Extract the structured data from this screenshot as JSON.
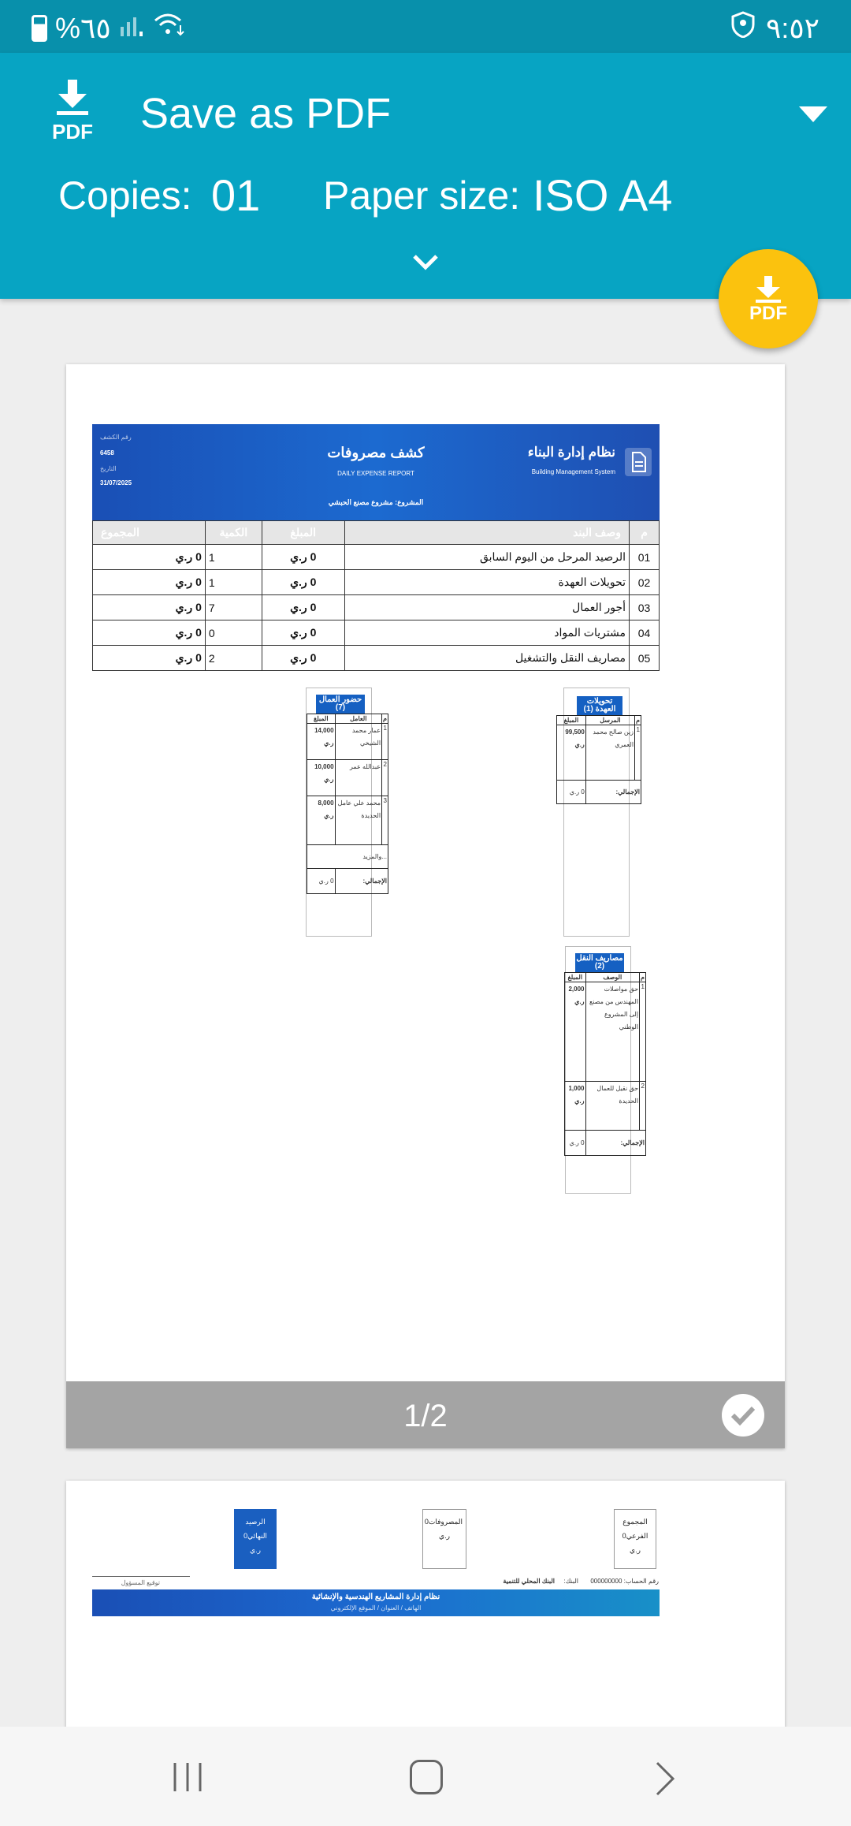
{
  "status_bar": {
    "battery": "%٦٥",
    "time": "٩:٥٢"
  },
  "header": {
    "title": "Save as PDF",
    "copies_label": "Copies:",
    "copies_value": "01",
    "paper_label": "Paper size:",
    "paper_value": "ISO A4",
    "pdf_icon_text": "PDF"
  },
  "fab": {
    "label": "PDF"
  },
  "page1": {
    "system_title": "نظام إدارة البناء",
    "system_subtitle": "Building Management System",
    "report_title": "كشف مصروفات",
    "report_subtitle": "DAILY EXPENSE REPORT",
    "project": "المشروع: مشروع مصنع الحبشي",
    "sheet_no_label": "رقم الكشف",
    "sheet_no": "6458",
    "date_label": "التاريخ",
    "date": "31/07/2025",
    "columns": [
      "م",
      "وصف البند",
      "المبلغ",
      "الكمية",
      "المجموع"
    ],
    "rows": [
      {
        "no": "01",
        "desc": "الرصيد المرحل من اليوم السابق",
        "amount": "0 ر.ي",
        "qty": "1",
        "total": "0 ر.ي"
      },
      {
        "no": "02",
        "desc": "تحويلات العهدة",
        "amount": "0 ر.ي",
        "qty": "1",
        "total": "0 ر.ي"
      },
      {
        "no": "03",
        "desc": "أجور العمال",
        "amount": "0 ر.ي",
        "qty": "7",
        "total": "0 ر.ي"
      },
      {
        "no": "04",
        "desc": "مشتريات المواد",
        "amount": "0 ر.ي",
        "qty": "0",
        "total": "0 ر.ي"
      },
      {
        "no": "05",
        "desc": "مصاريف النقل والتشغيل",
        "amount": "0 ر.ي",
        "qty": "2",
        "total": "0 ر.ي"
      }
    ],
    "transfers": {
      "title": "تحويلات العهدة (1)",
      "cols": [
        "م",
        "المرسل",
        "المبلغ"
      ],
      "rows": [
        {
          "no": "1",
          "name": "زين صالح محمد العمري",
          "amount": "99,500 ر.ي"
        }
      ],
      "total_label": "الإجمالي:",
      "total": "0 ر.ي"
    },
    "workers": {
      "title": "حضور العمال (7)",
      "cols": [
        "م",
        "العامل",
        "المبلغ"
      ],
      "rows": [
        {
          "no": "1",
          "name": "عمار محمد الشيخي",
          "amount": "14,000 ر.ي"
        },
        {
          "no": "2",
          "name": "عبدالله عمر",
          "amount": "10,000 ر.ي"
        },
        {
          "no": "3",
          "name": "محمد علي عامل الحديدة",
          "amount": "8,000 ر.ي"
        }
      ],
      "more": "...والمزيد",
      "total_label": "الإجمالي:",
      "total": "0 ر.ي"
    },
    "transport": {
      "title": "مصاريف النقل (2)",
      "cols": [
        "م",
        "الوصف",
        "المبلغ"
      ],
      "rows": [
        {
          "no": "1",
          "name": "حق مواصلات المهندس من مصنع إلى المشروع الوطني",
          "amount": "2,000 ر.ي"
        },
        {
          "no": "2",
          "name": "حق نقيل للعمال الحديدة",
          "amount": "1,000 ر.ي"
        }
      ],
      "total_label": "الإجمالي:",
      "total": "0 ر.ي"
    },
    "page_indicator": "1/2"
  },
  "page2": {
    "subtotal": "المجموع الفرعي0 ر.ي",
    "expenses": "المصروفات0 ر.ي",
    "final_balance": "الرصيد النهائي0 ر.ي",
    "account": "رقم الحساب: 000000000",
    "bank_label": "البنك:",
    "bank": "البنك المحلي للتنمية",
    "signature": "توقيع المسؤول",
    "footer_title": "نظام إدارة المشاريع الهندسية والإنشائية",
    "footer_sub": "الهاتف / العنوان / الموقع الإلكتروني"
  },
  "colors": {
    "header": "#07a4c3",
    "status": "#0890ab",
    "fab": "#fbc20e",
    "banner": "#1c6ad0"
  }
}
